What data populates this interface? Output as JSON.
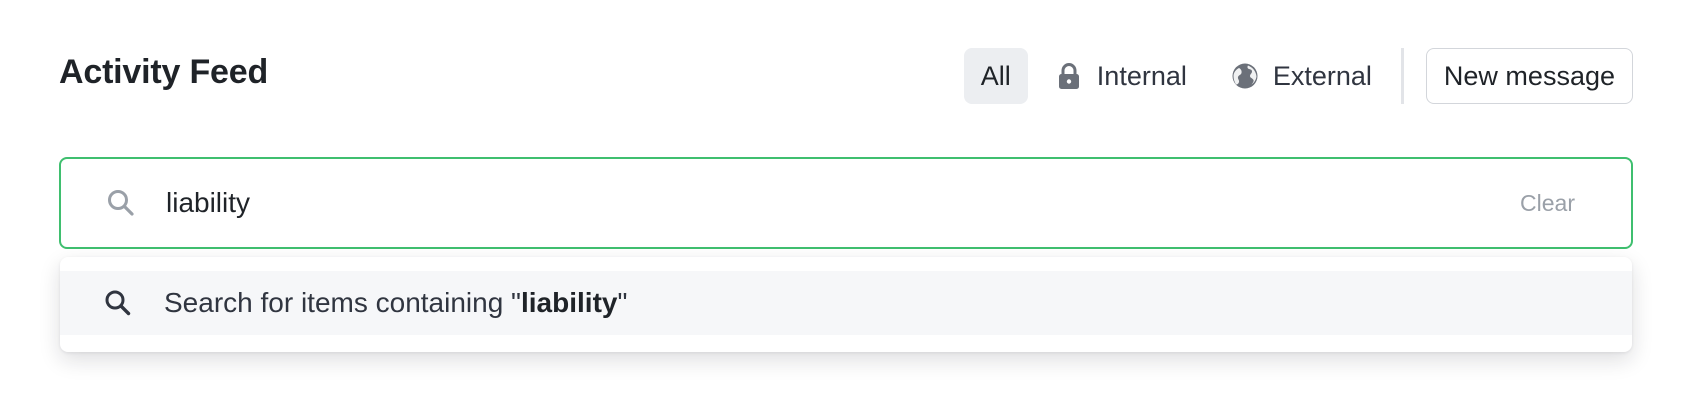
{
  "header": {
    "title": "Activity Feed"
  },
  "filters": {
    "all_label": "All",
    "internal_label": "Internal",
    "external_label": "External",
    "internal_icon": "lock-icon",
    "external_icon": "globe-icon",
    "active": "All"
  },
  "actions": {
    "new_message_label": "New message"
  },
  "search": {
    "value": "liability",
    "clear_label": "Clear",
    "icon": "search-icon",
    "focus_border_color": "#3fbf6f"
  },
  "suggestion": {
    "prefix": "Search for items containing \"",
    "query": "liability",
    "suffix": "\"",
    "icon": "search-icon"
  }
}
